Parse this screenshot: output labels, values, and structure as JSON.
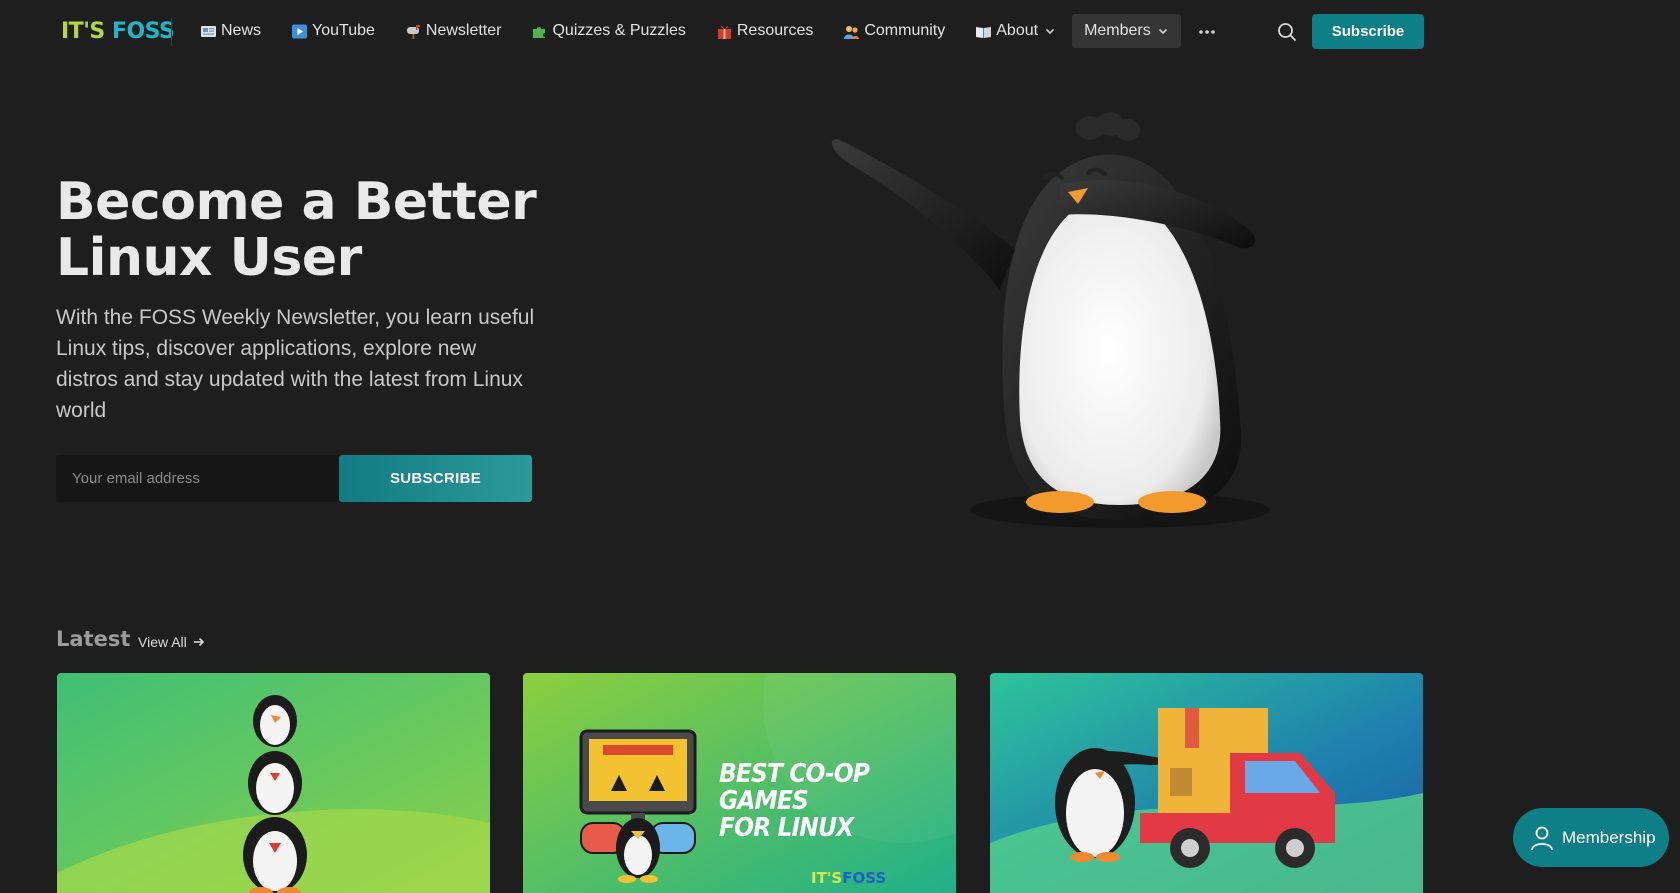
{
  "logo": {
    "part1": "IT'S",
    "part2": "FOSS"
  },
  "nav": {
    "items": [
      {
        "label": "News",
        "icon": "newspaper-icon"
      },
      {
        "label": "YouTube",
        "icon": "play-button-icon"
      },
      {
        "label": "Newsletter",
        "icon": "mailbox-icon"
      },
      {
        "label": "Quizzes & Puzzles",
        "icon": "puzzle-piece-icon"
      },
      {
        "label": "Resources",
        "icon": "gift-icon"
      },
      {
        "label": "Community",
        "icon": "people-icon"
      },
      {
        "label": "About",
        "icon": "book-icon"
      },
      {
        "label": "Members"
      }
    ],
    "subscribe_label": "Subscribe"
  },
  "hero": {
    "title_line1": "Become a Better",
    "title_line2": "Linux User",
    "description": "With the FOSS Weekly Newsletter, you learn useful Linux tips, discover applications, explore new distros and stay updated with the latest from Linux world",
    "email_placeholder": "Your email address",
    "subscribe_label": "SUBSCRIBE"
  },
  "latest": {
    "title": "Latest",
    "view_all": "View All",
    "cards": [
      {
        "caption_line1": "",
        "caption_line2": ""
      },
      {
        "caption_line1": "BEST CO-OP GAMES",
        "caption_line2": "FOR LINUX",
        "logo_a": "IT'S",
        "logo_b": "FOSS"
      },
      {
        "caption_line1": "",
        "caption_line2": ""
      }
    ]
  },
  "fab": {
    "label": "Membership"
  },
  "colors": {
    "background": "#1e1e1e",
    "accent": "#0e7f86",
    "logo_green": "#b5d63f",
    "logo_teal": "#1fb6c8"
  }
}
